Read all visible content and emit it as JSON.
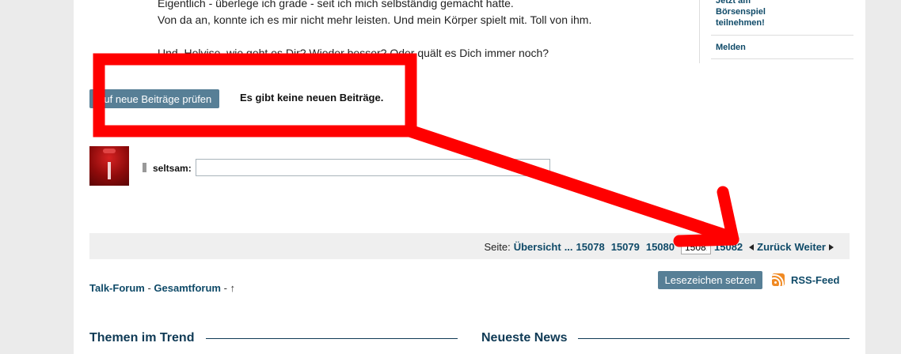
{
  "post": {
    "lines": [
      "Eigentlich - überlege ich grade  -  seit ich mich selbständig gemacht hatte.",
      "Von da an, konnte ich es mir nicht mehr leisten. Und mein Körper spielt mit. Toll von ihm.",
      "Und, Helvise, wie geht es Dir? Wieder besser? Oder quält es Dich immer noch?"
    ]
  },
  "sidebar": {
    "items": [
      {
        "label": "Jetzt am Börsenspiel teilnehmen!"
      },
      {
        "label": "Melden"
      }
    ]
  },
  "actions": {
    "check_new_label": "Auf neue Beiträge prüfen",
    "no_new_text": "Es gibt keine neuen Beiträge."
  },
  "reply": {
    "username": "seltsam:",
    "value": ""
  },
  "pager": {
    "prefix": "Seite:",
    "overview": "Übersicht",
    "ellipsis": "...",
    "pages": [
      "15078",
      "15079",
      "15080"
    ],
    "current": "15081",
    "next_page": "15082",
    "back": "Zurück",
    "forward": "Weiter"
  },
  "breadcrumb": {
    "forum": "Talk-Forum",
    "sep1": "-",
    "sub": "Gesamtforum",
    "sep2": "-",
    "up": "↑"
  },
  "bookmark_label": "Lesezeichen setzen",
  "rss_label": "RSS-Feed",
  "sections": {
    "trend": "Themen im Trend",
    "news": "Neueste News"
  },
  "colors": {
    "accent": "#0f4a68",
    "button": "#577f96",
    "annotation": "#ff0000"
  },
  "icons": {
    "rss": "rss-icon",
    "prev": "triangle-left-icon",
    "next": "triangle-right-icon"
  }
}
